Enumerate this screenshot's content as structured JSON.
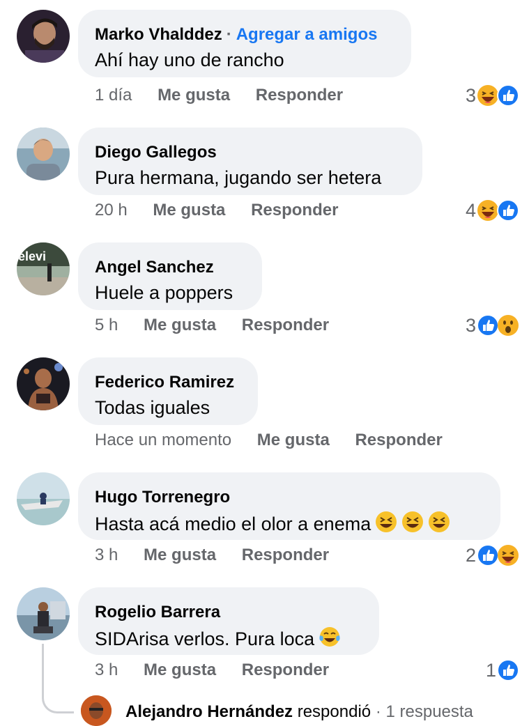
{
  "comments": [
    {
      "name": "Marko Vhalddez",
      "add_friend": "Agregar a amigos",
      "separator": "·",
      "text": "Ahí hay uno de rancho",
      "time": "1 día",
      "like": "Me gusta",
      "reply": "Responder",
      "count": "3",
      "reactions": [
        "haha",
        "like"
      ]
    },
    {
      "name": "Diego Gallegos",
      "text": "Pura hermana, jugando ser hetera",
      "time": "20 h",
      "like": "Me gusta",
      "reply": "Responder",
      "count": "4",
      "reactions": [
        "haha",
        "like"
      ]
    },
    {
      "name": "Angel Sanchez",
      "text": "Huele a poppers",
      "time": "5 h",
      "like": "Me gusta",
      "reply": "Responder",
      "count": "3",
      "reactions": [
        "like",
        "wow"
      ]
    },
    {
      "name": "Federico Ramirez",
      "text": "Todas iguales",
      "time": "Hace un momento",
      "like": "Me gusta",
      "reply": "Responder",
      "count": "",
      "reactions": []
    },
    {
      "name": "Hugo Torrenegro",
      "text": "Hasta acá medio el olor a enema",
      "emojis": [
        "laughing-emoji",
        "laughing-emoji",
        "laughing-emoji"
      ],
      "time": "3 h",
      "like": "Me gusta",
      "reply": "Responder",
      "count": "2",
      "reactions": [
        "like",
        "haha"
      ]
    },
    {
      "name": "Rogelio Barrera",
      "text": "SIDArisa verlos. Pura loca",
      "emojis": [
        "tears-of-joy-emoji"
      ],
      "time": "3 h",
      "like": "Me gusta",
      "reply": "Responder",
      "count": "1",
      "reactions": [
        "like"
      ]
    }
  ],
  "reply_preview": {
    "name": "Alejandro Hernández",
    "verb": "respondió",
    "separator": "·",
    "count": "1 respuesta"
  },
  "colors": {
    "bubble": "#f0f2f5",
    "link": "#1877f2",
    "muted": "#65676b",
    "like": "#1877f2",
    "haha": "#f7b125"
  }
}
